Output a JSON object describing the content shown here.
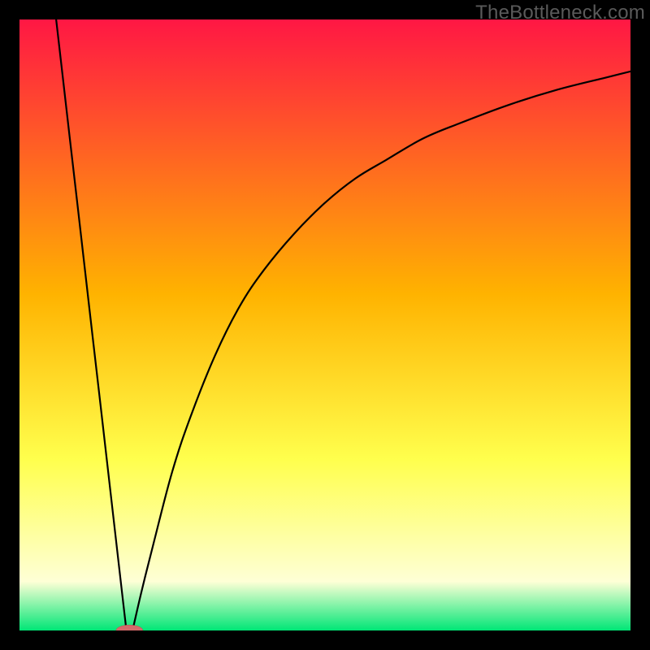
{
  "attribution": "TheBottleneck.com",
  "colors": {
    "frame": "#000000",
    "top": "#ff1744",
    "mid": "#ffb300",
    "yellow": "#ffff4d",
    "pale": "#feffd6",
    "green": "#00e676",
    "curve": "#000000",
    "marker_fill": "#d46a6a",
    "marker_stroke": "#b55050"
  },
  "chart_data": {
    "type": "line",
    "title": "",
    "xlabel": "",
    "ylabel": "",
    "xlim": [
      0,
      100
    ],
    "ylim": [
      0,
      100
    ],
    "series": [
      {
        "name": "left-branch",
        "x": [
          6.0,
          7.0,
          8.25,
          9.5,
          10.75,
          12.0,
          13.25,
          14.5,
          15.75,
          17.0,
          17.5
        ],
        "y": [
          100,
          91.3,
          80.4,
          69.6,
          58.7,
          47.8,
          37.0,
          26.1,
          15.2,
          4.3,
          0.0
        ]
      },
      {
        "name": "right-branch",
        "x": [
          18.5,
          20,
          22,
          25,
          28,
          32,
          36,
          40,
          45,
          50,
          55,
          60,
          66,
          72,
          80,
          88,
          96,
          100
        ],
        "y": [
          0.0,
          6.5,
          14.5,
          26.0,
          35.0,
          45.0,
          53.0,
          59.0,
          65.0,
          70.0,
          74.0,
          77.0,
          80.5,
          83.0,
          86.0,
          88.5,
          90.5,
          91.5
        ]
      }
    ],
    "marker": {
      "x": 18.0,
      "y": 0.0,
      "rx": 2.2,
      "ry": 0.9
    }
  }
}
